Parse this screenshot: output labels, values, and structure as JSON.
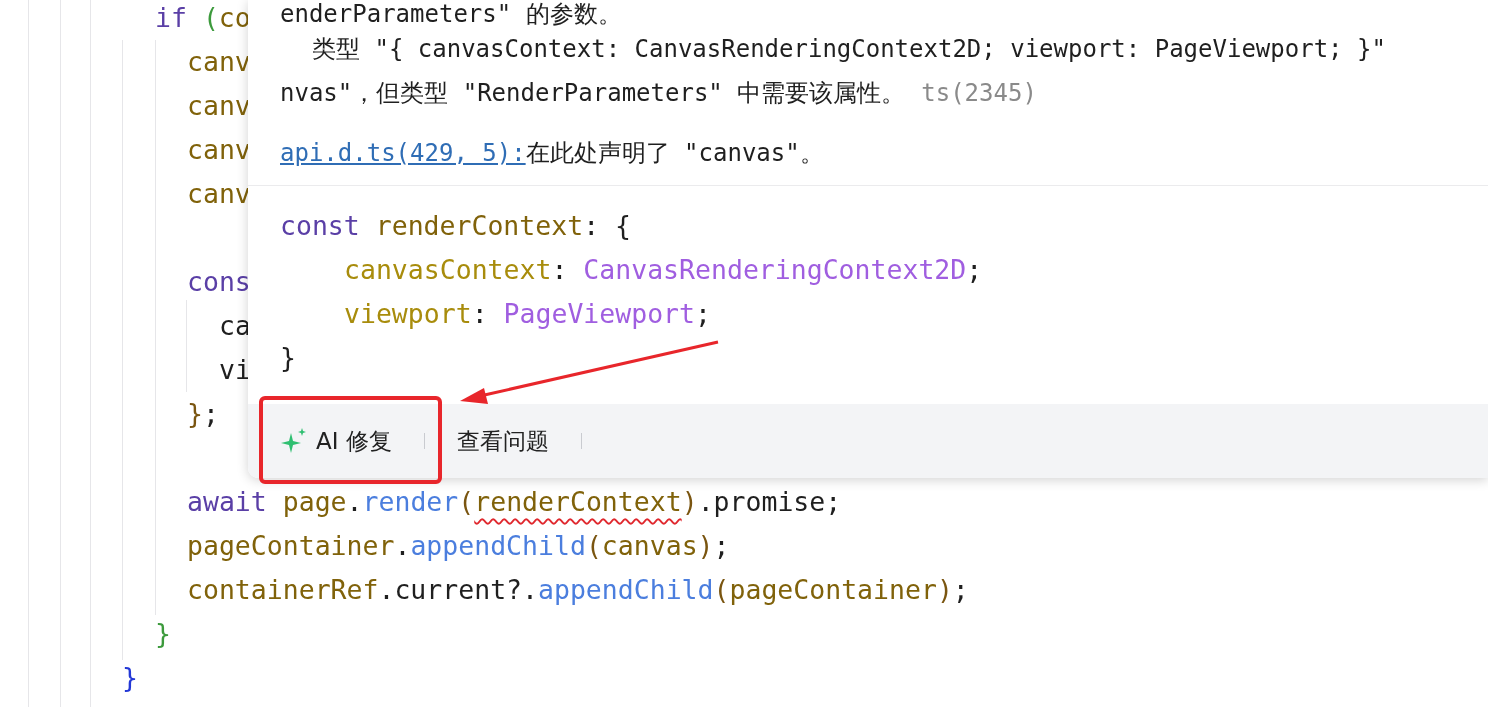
{
  "editor": {
    "lines": [
      {
        "kind": "code",
        "tokens": [
          {
            "text": "if ",
            "kind": "keyword"
          },
          {
            "text": "(",
            "kind": "paren"
          },
          {
            "text": "co",
            "kind": "variable"
          }
        ],
        "children": [
          {
            "kind": "code",
            "tokens": [
              {
                "text": "canv",
                "kind": "variable"
              }
            ]
          },
          {
            "kind": "code",
            "tokens": [
              {
                "text": "canv",
                "kind": "variable"
              }
            ]
          },
          {
            "kind": "code",
            "tokens": [
              {
                "text": "canv",
                "kind": "variable"
              }
            ]
          },
          {
            "kind": "code",
            "tokens": [
              {
                "text": "canv",
                "kind": "variable"
              }
            ]
          },
          {
            "kind": "blank"
          },
          {
            "kind": "code",
            "tokens": [
              {
                "text": "cons",
                "kind": "keyword"
              }
            ],
            "children": [
              {
                "kind": "code",
                "tokens": [
                  {
                    "text": "ca",
                    "kind": "plain"
                  }
                ]
              },
              {
                "kind": "code",
                "tokens": [
                  {
                    "text": "vi",
                    "kind": "plain"
                  }
                ]
              }
            ]
          },
          {
            "kind": "code",
            "tokens": [
              {
                "text": "}",
                "kind": "brace"
              },
              {
                "text": ";",
                "kind": "plain"
              }
            ]
          },
          {
            "kind": "blank"
          },
          {
            "kind": "code",
            "tokens": [
              {
                "text": "await ",
                "kind": "keyword"
              },
              {
                "text": "page",
                "kind": "variable"
              },
              {
                "text": ".",
                "kind": "plain"
              },
              {
                "text": "render",
                "kind": "method"
              },
              {
                "text": "(",
                "kind": "brace"
              },
              {
                "text": "renderContext",
                "kind": "variable",
                "error": true
              },
              {
                "text": ")",
                "kind": "brace"
              },
              {
                "text": ".promise;",
                "kind": "plain"
              }
            ]
          },
          {
            "kind": "code",
            "tokens": [
              {
                "text": "pageContainer",
                "kind": "variable"
              },
              {
                "text": ".",
                "kind": "plain"
              },
              {
                "text": "appendChild",
                "kind": "method"
              },
              {
                "text": "(",
                "kind": "brace"
              },
              {
                "text": "canvas",
                "kind": "variable"
              },
              {
                "text": ")",
                "kind": "brace"
              },
              {
                "text": ";",
                "kind": "plain"
              }
            ]
          },
          {
            "kind": "code",
            "tokens": [
              {
                "text": "containerRef",
                "kind": "variable"
              },
              {
                "text": ".current?.",
                "kind": "plain"
              },
              {
                "text": "appendChild",
                "kind": "method"
              },
              {
                "text": "(",
                "kind": "brace"
              },
              {
                "text": "pageContainer",
                "kind": "variable"
              },
              {
                "text": ")",
                "kind": "brace"
              },
              {
                "text": ";",
                "kind": "plain"
              }
            ]
          }
        ]
      },
      {
        "kind": "code",
        "tokens": [
          {
            "text": "}",
            "kind": "paren"
          }
        ]
      }
    ],
    "closing_lines": [
      {
        "kind": "code",
        "tokens": [
          {
            "text": "}",
            "kind": "outer"
          }
        ]
      }
    ]
  },
  "popup": {
    "message": [
      "enderParameters\" 的参数。",
      "类型 \"{ canvasContext: CanvasRenderingContext2D; viewport: PageViewport; }\""
    ],
    "message_line": {
      "text": "nvas\"，但类型 \"RenderParameters\" 中需要该属性。",
      "code": "ts(2345)"
    },
    "reference": {
      "link": "api.d.ts(429, 5): ",
      "text": "在此处声明了 \"canvas\"。"
    },
    "code": [
      {
        "kind": "code",
        "tokens": [
          {
            "text": "const ",
            "kind": "keyword"
          },
          {
            "text": "renderContext",
            "kind": "variable"
          },
          {
            "text": ": {",
            "kind": "plain"
          }
        ],
        "children": [
          {
            "kind": "code",
            "tokens": [
              {
                "text": "canvasContext",
                "kind": "property"
              },
              {
                "text": ": ",
                "kind": "plain"
              },
              {
                "text": "CanvasRenderingContext2D",
                "kind": "type"
              },
              {
                "text": ";",
                "kind": "plain"
              }
            ]
          },
          {
            "kind": "code",
            "tokens": [
              {
                "text": "viewport",
                "kind": "property"
              },
              {
                "text": ": ",
                "kind": "plain"
              },
              {
                "text": "PageViewport",
                "kind": "type"
              },
              {
                "text": ";",
                "kind": "plain"
              }
            ]
          }
        ]
      },
      {
        "kind": "code",
        "tokens": [
          {
            "text": "}",
            "kind": "plain"
          }
        ]
      }
    ],
    "actions": [
      {
        "label": "AI 修复",
        "kind": "ai",
        "highlighted": true
      },
      {
        "label": "查看问题",
        "kind": "plain",
        "highlighted": false
      }
    ]
  }
}
